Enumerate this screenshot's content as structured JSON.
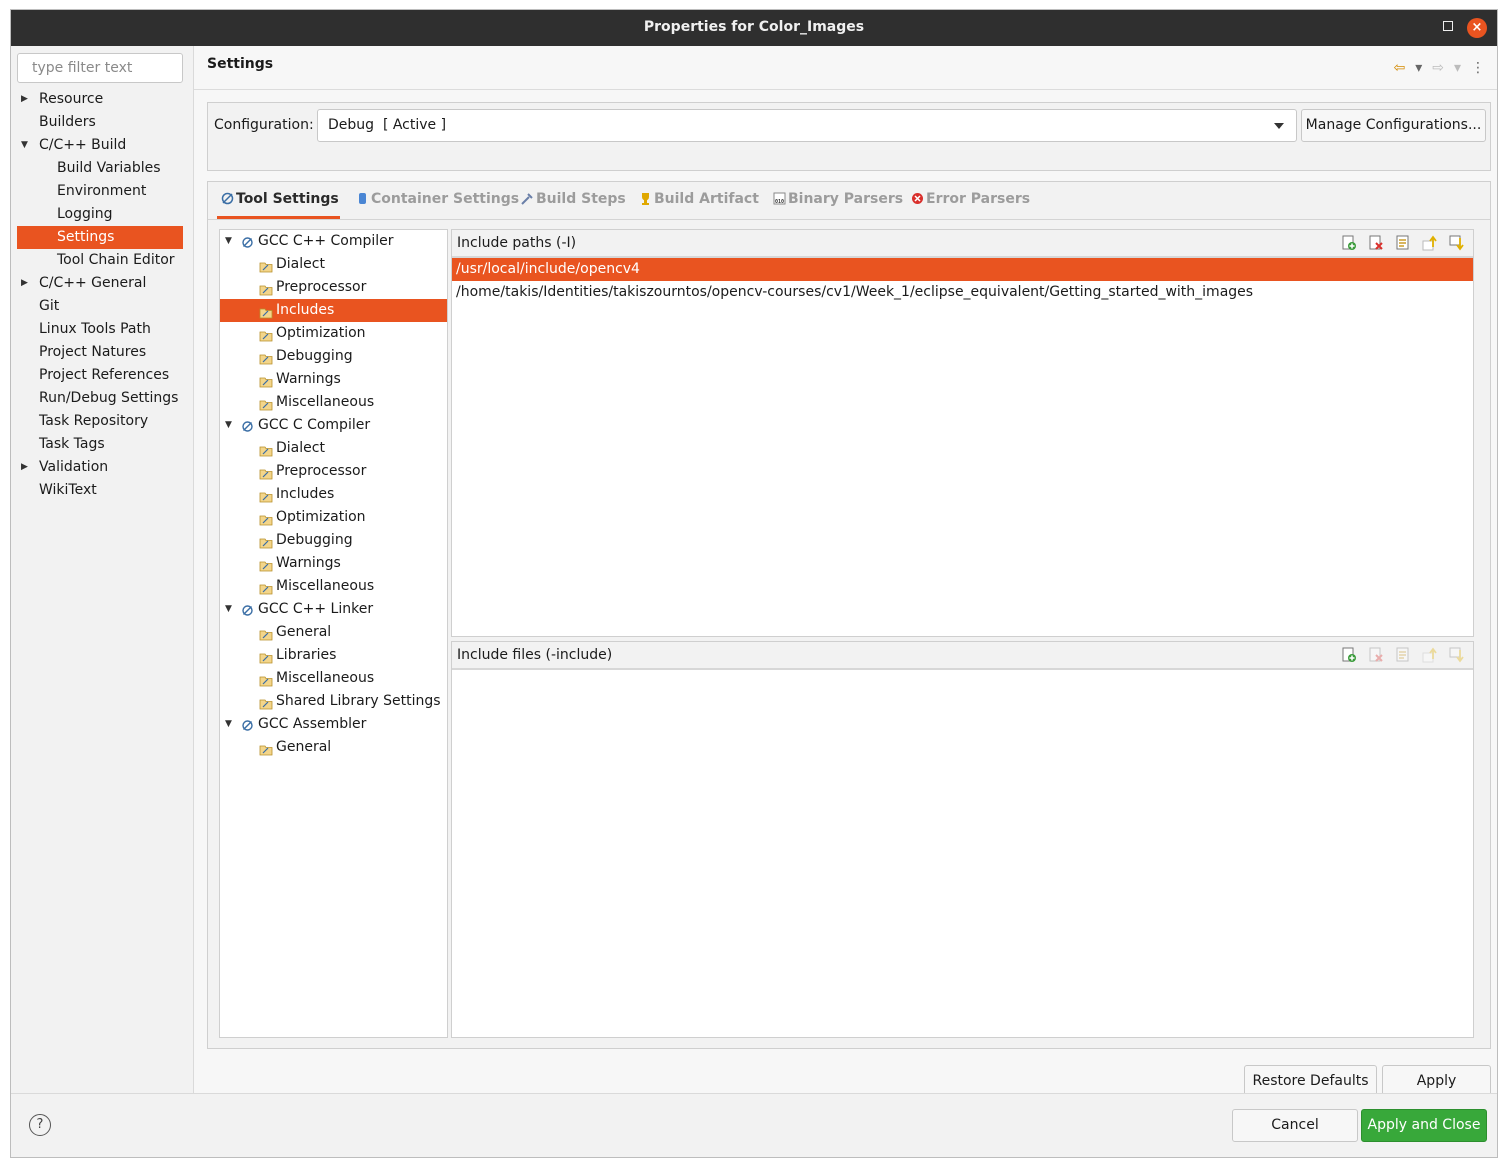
{
  "window": {
    "title": "Properties for Color_Images"
  },
  "filter": {
    "placeholder": "type filter text"
  },
  "nav": {
    "items": [
      {
        "label": "Resource",
        "expandable": "collapsed"
      },
      {
        "label": "Builders"
      },
      {
        "label": "C/C++ Build",
        "expandable": "expanded"
      },
      {
        "label": "Build Variables",
        "child": true
      },
      {
        "label": "Environment",
        "child": true
      },
      {
        "label": "Logging",
        "child": true
      },
      {
        "label": "Settings",
        "child": true,
        "selected": true
      },
      {
        "label": "Tool Chain Editor",
        "child": true
      },
      {
        "label": "C/C++ General",
        "expandable": "collapsed"
      },
      {
        "label": "Git"
      },
      {
        "label": "Linux Tools Path"
      },
      {
        "label": "Project Natures"
      },
      {
        "label": "Project References"
      },
      {
        "label": "Run/Debug Settings"
      },
      {
        "label": "Task Repository"
      },
      {
        "label": "Task Tags"
      },
      {
        "label": "Validation",
        "expandable": "collapsed"
      },
      {
        "label": "WikiText"
      }
    ]
  },
  "page": {
    "title": "Settings"
  },
  "configuration": {
    "label": "Configuration:",
    "value": "Debug  [ Active ]",
    "manage_label": "Manage Configurations..."
  },
  "tabs": [
    {
      "label": "Tool Settings",
      "icon": "tool-icon",
      "active": true
    },
    {
      "label": "Container Settings",
      "icon": "container-icon"
    },
    {
      "label": "Build Steps",
      "icon": "build-steps-icon"
    },
    {
      "label": "Build Artifact",
      "icon": "trophy-icon"
    },
    {
      "label": "Binary Parsers",
      "icon": "binary-icon"
    },
    {
      "label": "Error Parsers",
      "icon": "error-icon"
    }
  ],
  "tool_tree": [
    {
      "label": "GCC C++ Compiler",
      "children": [
        {
          "label": "Dialect"
        },
        {
          "label": "Preprocessor"
        },
        {
          "label": "Includes",
          "selected": true
        },
        {
          "label": "Optimization"
        },
        {
          "label": "Debugging"
        },
        {
          "label": "Warnings"
        },
        {
          "label": "Miscellaneous"
        }
      ]
    },
    {
      "label": "GCC C Compiler",
      "children": [
        {
          "label": "Dialect"
        },
        {
          "label": "Preprocessor"
        },
        {
          "label": "Includes"
        },
        {
          "label": "Optimization"
        },
        {
          "label": "Debugging"
        },
        {
          "label": "Warnings"
        },
        {
          "label": "Miscellaneous"
        }
      ]
    },
    {
      "label": "GCC C++ Linker",
      "children": [
        {
          "label": "General"
        },
        {
          "label": "Libraries"
        },
        {
          "label": "Miscellaneous"
        },
        {
          "label": "Shared Library Settings"
        }
      ]
    },
    {
      "label": "GCC Assembler",
      "children": [
        {
          "label": "General"
        }
      ]
    }
  ],
  "include_paths": {
    "label": "Include paths (-I)",
    "items": [
      "/usr/local/include/opencv4",
      "/home/takis/Identities/takiszourntos/opencv-courses/cv1/Week_1/eclipse_equivalent/Getting_started_with_images"
    ]
  },
  "include_files": {
    "label": "Include files (-include)",
    "items": []
  },
  "buttons": {
    "restore_defaults": "Restore Defaults",
    "apply": "Apply",
    "cancel": "Cancel",
    "apply_and_close": "Apply and Close"
  },
  "colors": {
    "selection": "#e95420",
    "primary": "#38a83a",
    "titlebar": "#2f2f2f"
  }
}
